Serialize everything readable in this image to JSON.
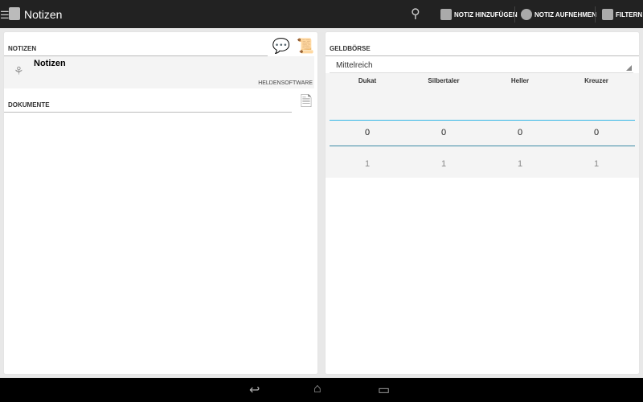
{
  "app": {
    "title": "Notizen"
  },
  "actions": {
    "add_note": "NOTIZ HINZUFÜGEN",
    "record_note": "NOTIZ AUFNEHMEN",
    "filter": "FILTERN"
  },
  "notes": {
    "header": "NOTIZEN",
    "item": {
      "title": "Notizen",
      "source": "HELDENSOFTWARE"
    },
    "documents_header": "DOKUMENTE"
  },
  "wallet": {
    "header": "GELDBÖRSE",
    "region": "Mittelreich",
    "columns": [
      {
        "name": "Dukat",
        "amount": "0",
        "rate": "1"
      },
      {
        "name": "Silbertaler",
        "amount": "0",
        "rate": "1"
      },
      {
        "name": "Heller",
        "amount": "0",
        "rate": "1"
      },
      {
        "name": "Kreuzer",
        "amount": "0",
        "rate": "1"
      }
    ]
  },
  "colors": {
    "accent": "#33b5e5",
    "bar": "#222222"
  }
}
